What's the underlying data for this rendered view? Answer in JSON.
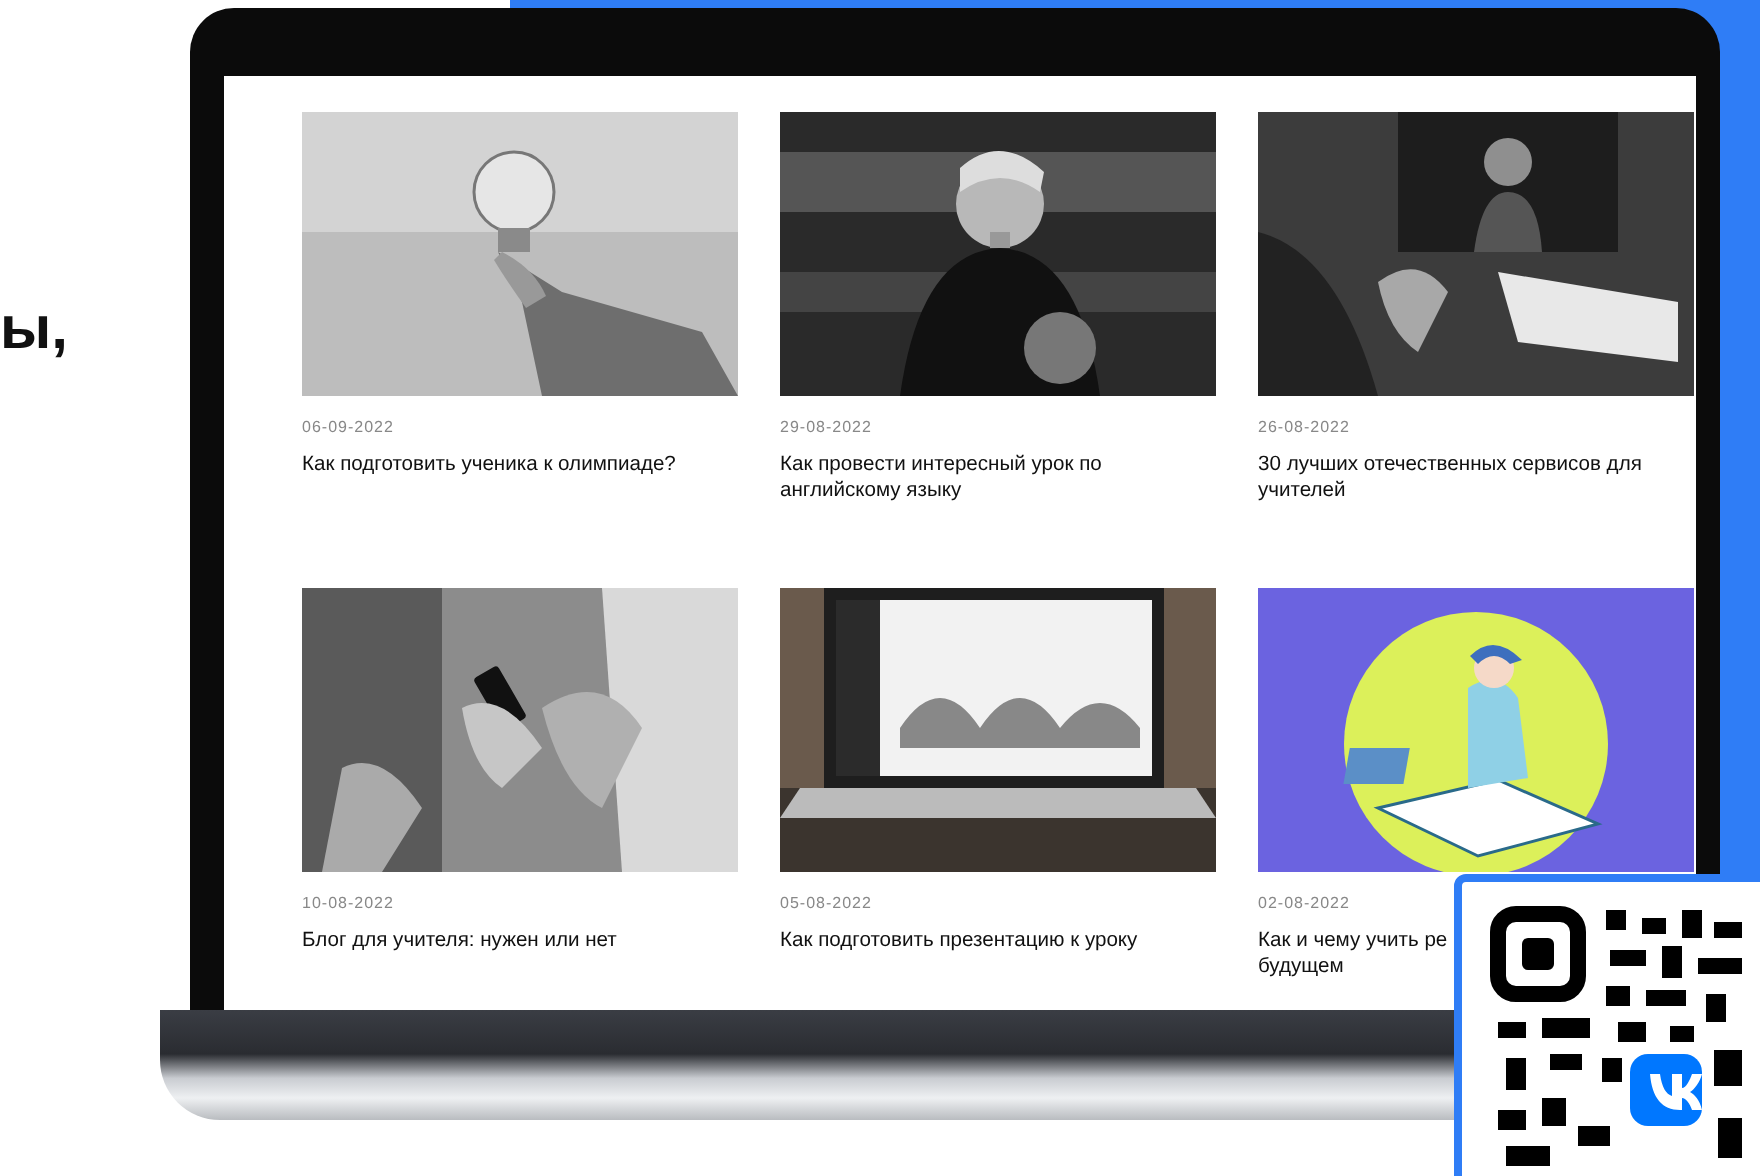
{
  "side_text": "ы,",
  "articles": [
    {
      "date": "06-09-2022",
      "title": "Как подготовить ученика к олимпиаде?"
    },
    {
      "date": "29-08-2022",
      "title": "Как провести интересный урок по английскому языку"
    },
    {
      "date": "26-08-2022",
      "title": "30 лучших отечественных сервисов для учителей"
    },
    {
      "date": "10-08-2022",
      "title": "Блог для учителя: нужен или нет"
    },
    {
      "date": "05-08-2022",
      "title": "Как подготовить презентацию к уроку"
    },
    {
      "date": "02-08-2022",
      "title": "Как и чему учить ре\nбудущем"
    }
  ]
}
